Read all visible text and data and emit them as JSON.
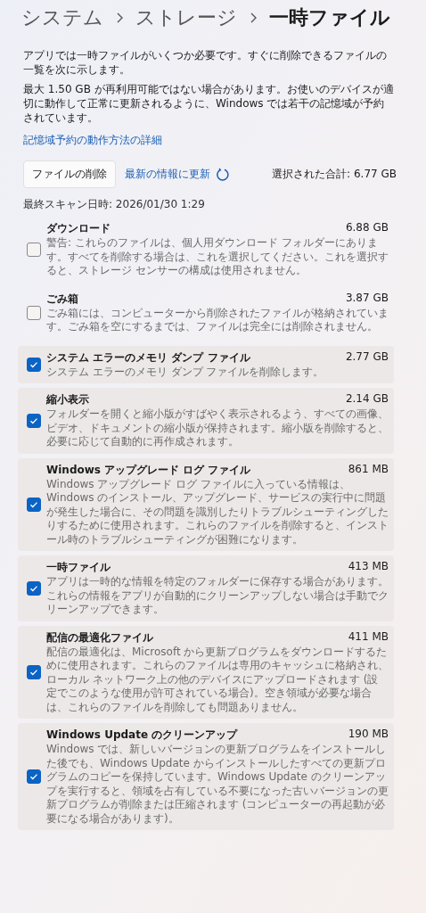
{
  "breadcrumb": [
    {
      "label": "システム",
      "current": false
    },
    {
      "label": "ストレージ",
      "current": false
    },
    {
      "label": "一時ファイル",
      "current": true
    }
  ],
  "intro": [
    "アプリでは一時ファイルがいくつか必要です。すぐに削除できるファイルの一覧を次に示します。",
    "最大 1.50 GB が再利用可能ではない場合があります。お使いのデバイスが適切に動作して正常に更新されるように、Windows では若干の記憶域が予約されています。"
  ],
  "learn_more_link": "記憶域予約の動作方法の詳細",
  "toolbar": {
    "delete_button": "ファイルの削除",
    "refresh_link": "最新の情報に更新",
    "selected_total": "選択された合計: 6.77 GB"
  },
  "last_scan": "最終スキャン日時: 2026/01/30 1:29",
  "items": [
    {
      "name": "ダウンロード",
      "size": "6.88 GB",
      "description": "警告: これらのファイルは、個人用ダウンロード フォルダーにあります。すべてを削除する場合は、これを選択してください。これを選択すると、ストレージ センサーの構成は使用されません。",
      "checked": false
    },
    {
      "name": "ごみ箱",
      "size": "3.87 GB",
      "description": "ごみ箱には、コンピューターから削除されたファイルが格納されています。ごみ箱を空にするまでは、ファイルは完全には削除されません。",
      "checked": false
    },
    {
      "name": "システム エラーのメモリ ダンプ ファイル",
      "size": "2.77 GB",
      "description": "システム エラーのメモリ ダンプ ファイルを削除します。",
      "checked": true
    },
    {
      "name": "縮小表示",
      "size": "2.14 GB",
      "description": "フォルダーを開くと縮小版がすばやく表示されるよう、すべての画像、ビデオ、ドキュメントの縮小版が保持されます。縮小版を削除すると、必要に応じて自動的に再作成されます。",
      "checked": true
    },
    {
      "name": "Windows アップグレード ログ ファイル",
      "size": "861 MB",
      "description": "Windows アップグレード ログ ファイルに入っている情報は、Windows のインストール、アップグレード、サービスの実行中に問題が発生した場合に、その問題を識別したりトラブルシューティングしたりするために使用されます。これらのファイルを削除すると、インストール時のトラブルシューティングが困難になります。",
      "checked": true
    },
    {
      "name": "一時ファイル",
      "size": "413 MB",
      "description": "アプリは一時的な情報を特定のフォルダーに保存する場合があります。これらの情報をアプリが自動的にクリーンアップしない場合は手動でクリーンアップできます。",
      "checked": true
    },
    {
      "name": "配信の最適化ファイル",
      "size": "411 MB",
      "description": "配信の最適化は、Microsoft から更新プログラムをダウンロードするために使用されます。これらのファイルは専用のキャッシュに格納され、ローカル ネットワーク上の他のデバイスにアップロードされます (設定でこのような使用が許可されている場合)。空き領域が必要な場合は、これらのファイルを削除しても問題ありません。",
      "checked": true
    },
    {
      "name": "Windows Update のクリーンアップ",
      "size": "190 MB",
      "description": "Windows では、新しいバージョンの更新プログラムをインストールした後でも、Windows Update からインストールしたすべての更新プログラムのコピーを保持しています。Windows Update のクリーンアップを実行すると、領域を占有している不要になった古いバージョンの更新プログラムが削除または圧縮されます (コンピューターの再起動が必要になる場合があります)。",
      "checked": true
    }
  ]
}
